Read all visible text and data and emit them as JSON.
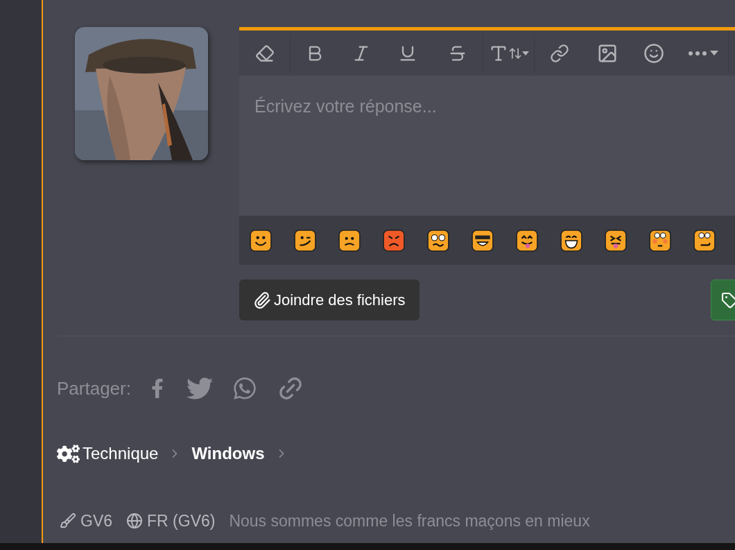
{
  "editor": {
    "placeholder": "Écrivez votre réponse..."
  },
  "attach_button": {
    "label": "Joindre des fichiers"
  },
  "share": {
    "label": "Partager:"
  },
  "breadcrumb": [
    {
      "label": "Technique",
      "current": false
    },
    {
      "label": "Windows",
      "current": true
    }
  ],
  "footer": {
    "style": "GV6",
    "language": "FR (GV6)",
    "tagline": "Nous sommes comme les francs maçons en mieux"
  }
}
